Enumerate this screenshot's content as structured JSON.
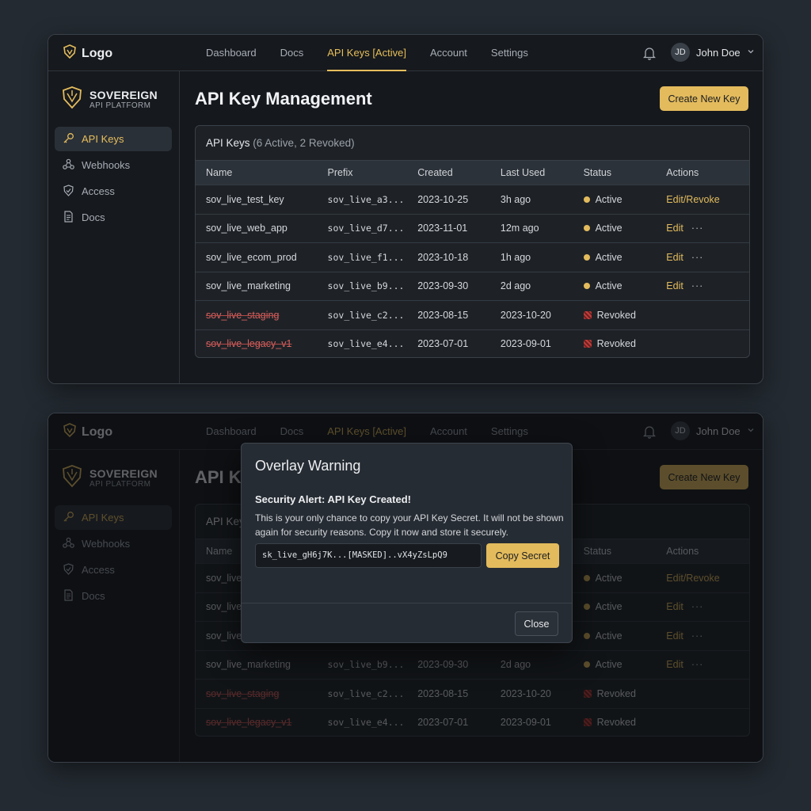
{
  "app": {
    "logo": "Logo",
    "brand_title": "SOVEREIGN",
    "brand_subtitle": "API PLATFORM"
  },
  "nav": [
    "Dashboard",
    "Docs",
    "API Keys [Active]",
    "Account",
    "Settings"
  ],
  "nav_active_index": 2,
  "user": {
    "initials": "JD",
    "name": "John Doe"
  },
  "sidebar": {
    "items": [
      {
        "label": "API Keys",
        "icon": "key-icon",
        "active": true
      },
      {
        "label": "Webhooks",
        "icon": "webhook-icon",
        "active": false
      },
      {
        "label": "Access",
        "icon": "shield-icon",
        "active": false
      },
      {
        "label": "Docs",
        "icon": "document-icon",
        "active": false
      }
    ]
  },
  "main": {
    "title": "API Key Management",
    "create_button": "Create New Key",
    "card_title": "API Keys",
    "card_summary": "(6 Active, 2 Revoked)",
    "columns": [
      "Name",
      "Prefix",
      "Created",
      "Last Used",
      "Status",
      "Actions"
    ],
    "rows": [
      {
        "name": "sov_live_test_key",
        "prefix": "sov_live_a3...",
        "created": "2023-10-25",
        "last_used": "3h ago",
        "status": "Active",
        "action": "Edit/Revoke",
        "more": ""
      },
      {
        "name": "sov_live_web_app",
        "prefix": "sov_live_d7...",
        "created": "2023-11-01",
        "last_used": "12m ago",
        "status": "Active",
        "action": "Edit",
        "more": "···"
      },
      {
        "name": "sov_live_ecom_prod",
        "prefix": "sov_live_f1...",
        "created": "2023-10-18",
        "last_used": "1h ago",
        "status": "Active",
        "action": "Edit",
        "more": "···"
      },
      {
        "name": "sov_live_marketing",
        "prefix": "sov_live_b9...",
        "created": "2023-09-30",
        "last_used": "2d ago",
        "status": "Active",
        "action": "Edit",
        "more": "···"
      },
      {
        "name": "sov_live_staging",
        "prefix": "sov_live_c2...",
        "created": "2023-08-15",
        "last_used": "2023-10-20",
        "status": "Revoked",
        "action": "",
        "more": ""
      },
      {
        "name": "sov_live_legacy_v1",
        "prefix": "sov_live_e4...",
        "created": "2023-07-01",
        "last_used": "2023-09-01",
        "status": "Revoked",
        "action": "",
        "more": ""
      }
    ]
  },
  "modal": {
    "title": "Overlay Warning",
    "alert_title": "Security Alert: API Key Created!",
    "message": "This is your only chance to copy your API Key Secret. It will not be shown again for security reasons. Copy it now and store it securely.",
    "secret": "sk_live_gH6j7K...[MASKED]..vX4yZsLpQ9",
    "copy_button": "Copy Secret",
    "close_button": "Close"
  },
  "colors": {
    "accent": "#e3bb5d",
    "revoked": "#d9625f",
    "background": "#232a31",
    "panel": "#15181c"
  }
}
